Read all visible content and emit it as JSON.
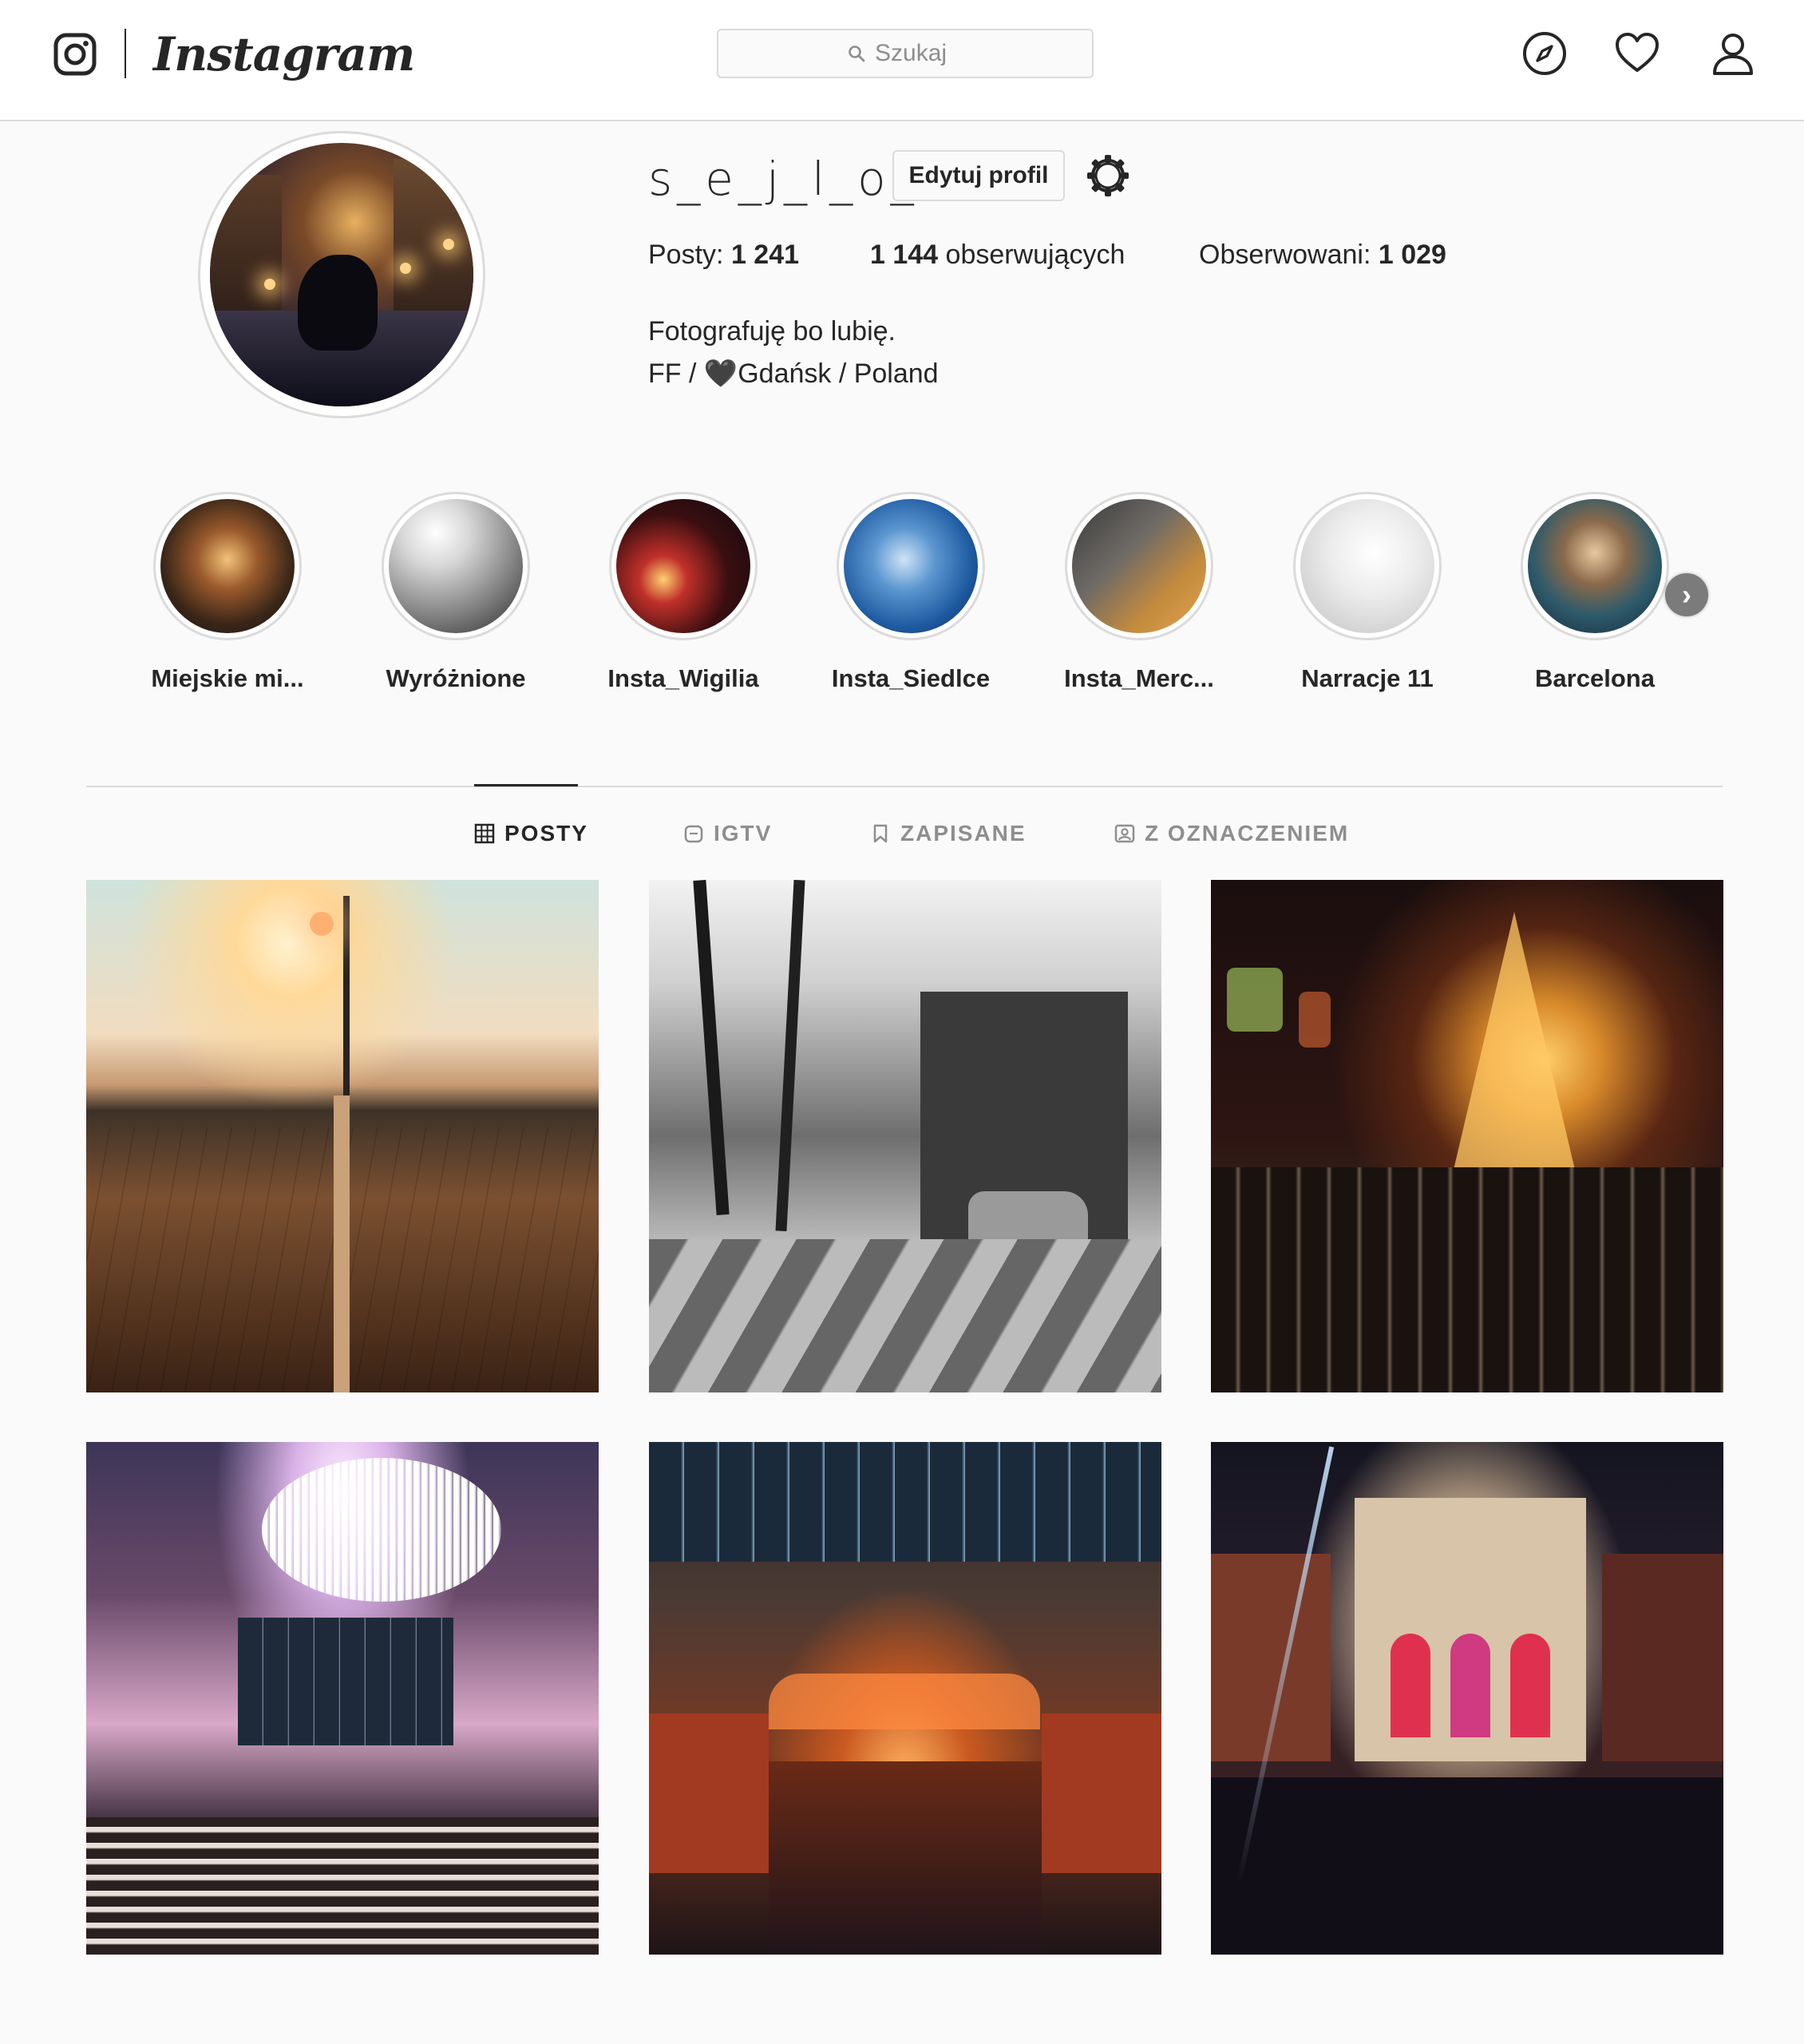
{
  "header": {
    "brand": "Instagram",
    "search": {
      "placeholder": "Szukaj"
    }
  },
  "profile": {
    "username": "s_e_j_l_o_r",
    "edit_label": "Edytuj profil",
    "stats": {
      "posts_label": "Posty:",
      "posts_value": "1 241",
      "followers_value": "1 144",
      "followers_label": "obserwujących",
      "following_label": "Obserwowani:",
      "following_value": "1 029"
    },
    "bio": {
      "line1": "Fotografuję bo lubię.",
      "line2": "FF / 🖤Gdańsk / Poland"
    }
  },
  "highlights": [
    {
      "label": "Miejskie mi..."
    },
    {
      "label": "Wyróżnione"
    },
    {
      "label": "Insta_Wigilia"
    },
    {
      "label": "Insta_Siedlce"
    },
    {
      "label": "Insta_Merc..."
    },
    {
      "label": "Narracje 11"
    },
    {
      "label": "Barcelona"
    }
  ],
  "tabs": [
    {
      "label": "POSTY",
      "icon": "grid-icon",
      "active": true
    },
    {
      "label": "IGTV",
      "icon": "igtv-icon",
      "active": false
    },
    {
      "label": "ZAPISANE",
      "icon": "bookmark-icon",
      "active": false
    },
    {
      "label": "Z OZNACZENIEM",
      "icon": "tagged-icon",
      "active": false
    }
  ],
  "colors": {
    "text": "#262626",
    "muted": "#8e8e8e",
    "border": "#dbdbdb",
    "background": "#fafafa"
  }
}
